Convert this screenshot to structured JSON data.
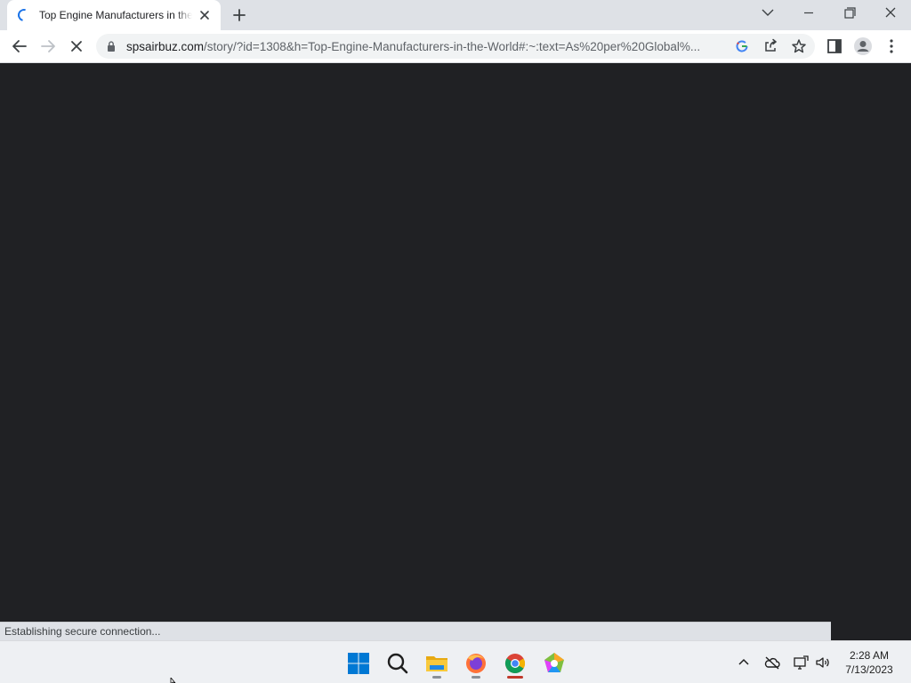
{
  "browser": {
    "tab": {
      "title": "Top Engine Manufacturers in the World"
    },
    "address_bar": {
      "host": "spsairbuz.com",
      "path": "/story/?id=1308&h=Top-Engine-Manufacturers-in-the-World#:~:text=As%20per%20Global%..."
    },
    "status_text": "Establishing secure connection...",
    "colors": {
      "page_background": "#202124",
      "accent": "#1a73e8"
    }
  },
  "taskbar": {
    "apps": [
      "windows-start",
      "search",
      "file-explorer",
      "firefox",
      "chrome",
      "paint-3d"
    ],
    "clock": {
      "time": "2:28 AM",
      "date": "7/13/2023"
    }
  }
}
